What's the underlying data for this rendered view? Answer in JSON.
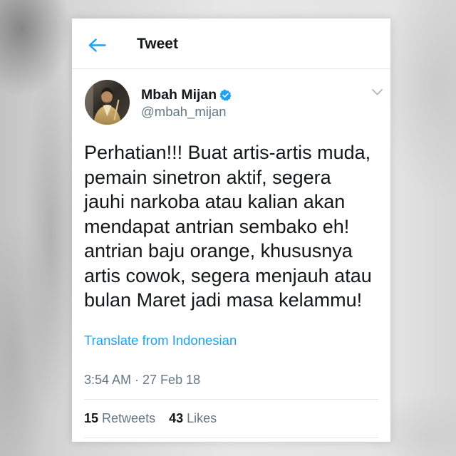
{
  "header": {
    "title": "Tweet",
    "back_icon": "arrow-left-icon"
  },
  "tweet": {
    "author": {
      "name": "Mbah Mijan",
      "handle": "@mbah_mijan",
      "verified": true,
      "verified_icon": "verified-badge-icon"
    },
    "menu_icon": "chevron-down-icon",
    "text_lines": [
      "Perhatian!!! Buat artis-artis muda,",
      "pemain sinetron aktif, segera",
      "jauhi narkoba atau kalian akan",
      "mendapat antrian sembako eh!",
      "antrian baju orange, khususnya",
      "artis cowok, segera menjauh atau",
      "bulan Maret jadi masa kelammu!"
    ],
    "translate_label": "Translate from Indonesian",
    "timestamp": "3:54 AM · 27 Feb 18",
    "stats": {
      "retweets_count": "15",
      "retweets_label": "Retweets",
      "likes_count": "43",
      "likes_label": "Likes"
    }
  },
  "colors": {
    "accent": "#1da1f2",
    "text_primary": "#14171a",
    "text_secondary": "#657786",
    "divider": "#e1e8ed",
    "icon_muted": "#aab8c2"
  }
}
